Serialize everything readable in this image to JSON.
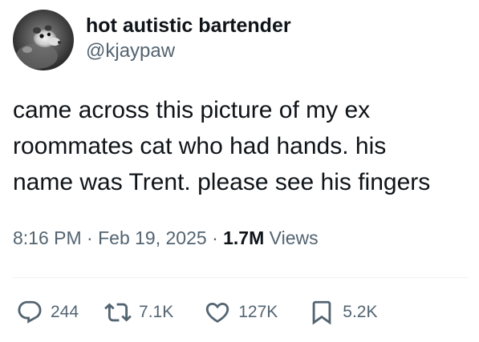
{
  "author": {
    "display_name": "hot autistic bartender",
    "handle": "@kjaypaw",
    "avatar_icon": "opossum-avatar"
  },
  "tweet": {
    "text_lines": [
      "came across this picture of my ex",
      "roommates cat who had hands. his",
      "name was Trent. please see his fingers"
    ],
    "time": "8:16 PM",
    "date": "Feb 19, 2025",
    "separator": "·",
    "views_count": "1.7M",
    "views_label": "Views"
  },
  "actions": {
    "reply": {
      "icon": "reply-icon",
      "count": "244"
    },
    "repost": {
      "icon": "repost-icon",
      "count": "7.1K"
    },
    "like": {
      "icon": "heart-icon",
      "count": "127K"
    },
    "bookmark": {
      "icon": "bookmark-icon",
      "count": "5.2K"
    }
  },
  "colors": {
    "text": "#0f1419",
    "secondary": "#536471",
    "divider": "#eff3f4"
  }
}
